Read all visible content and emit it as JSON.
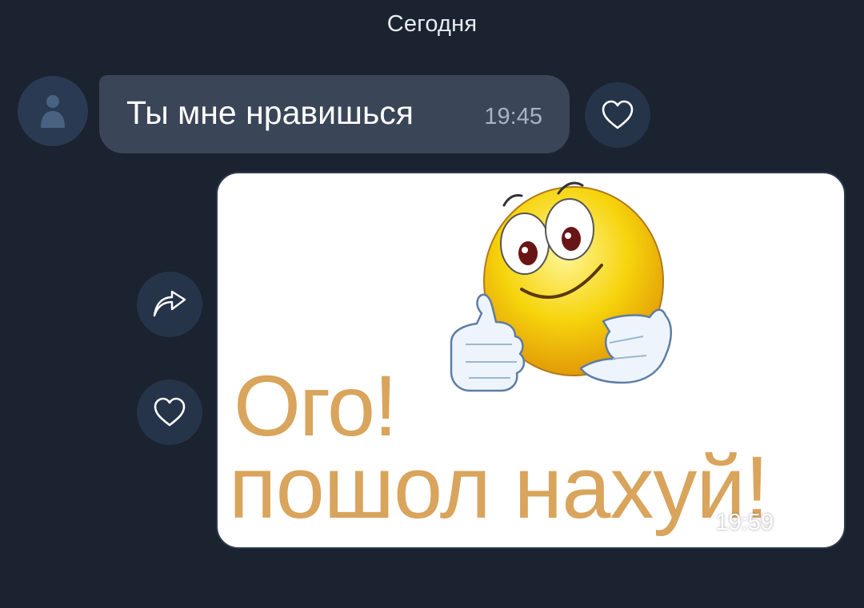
{
  "chat": {
    "date_separator": "Сегодня",
    "incoming": {
      "text": "Ты мне нравишься",
      "time": "19:45",
      "avatar_icon": "user-icon",
      "reaction_icon": "heart-icon"
    },
    "outgoing": {
      "sticker_line1": "Ого!",
      "sticker_line2": "пошол нахуй!",
      "time": "19:59",
      "status_icon": "double-check-icon",
      "share_icon": "share-arrow-icon",
      "reaction_icon": "heart-icon"
    }
  },
  "colors": {
    "background": "#1b2230",
    "incoming_bubble": "#3a4558",
    "round_button": "#26344a",
    "sticker_text": "#d9a45c"
  }
}
